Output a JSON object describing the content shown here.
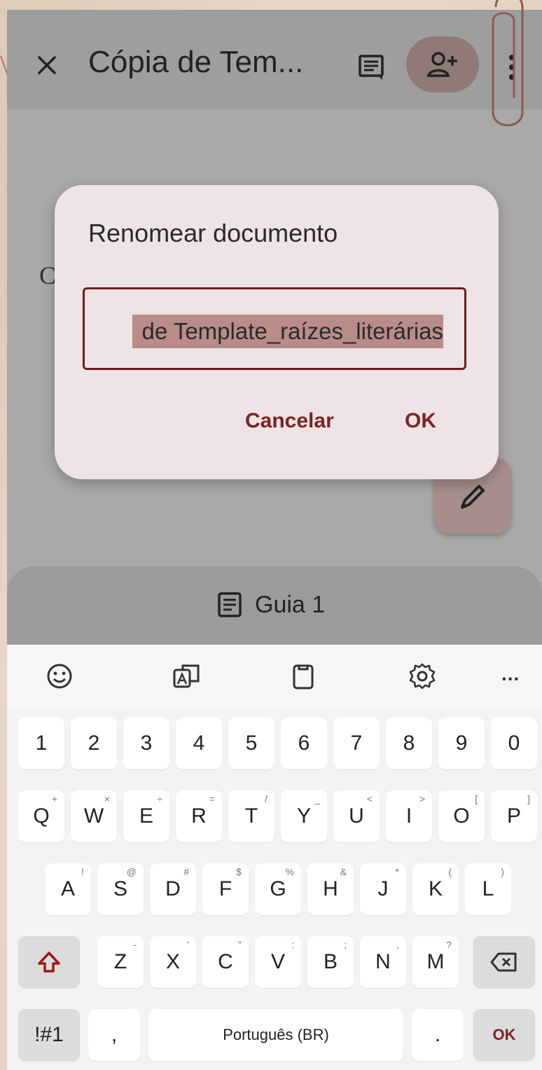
{
  "app_bar": {
    "title": "Cópia de Tem...",
    "close_icon": "close-icon",
    "comment_icon": "comment-icon",
    "share_icon": "person-add-icon",
    "more_icon": "more-vert-icon"
  },
  "document": {
    "visible_letter": "C"
  },
  "dialog": {
    "title": "Renomear documento",
    "field_value": "de Template_raízes_literárias",
    "cancel_label": "Cancelar",
    "ok_label": "OK"
  },
  "tab_bar": {
    "tab_label": "Guia 1",
    "tab_icon": "document-icon"
  },
  "keyboard": {
    "toolbar_icons": [
      "emoji-icon",
      "translate-icon",
      "clipboard-icon",
      "settings-icon",
      "more-horiz-icon"
    ],
    "more_label": "...",
    "row_numbers": [
      "1",
      "2",
      "3",
      "4",
      "5",
      "6",
      "7",
      "8",
      "9",
      "0"
    ],
    "row_q": [
      {
        "key": "Q",
        "sup": "+"
      },
      {
        "key": "W",
        "sup": "×"
      },
      {
        "key": "E",
        "sup": "÷"
      },
      {
        "key": "R",
        "sup": "="
      },
      {
        "key": "T",
        "sup": "/"
      },
      {
        "key": "Y",
        "sup": "_"
      },
      {
        "key": "U",
        "sup": "<"
      },
      {
        "key": "I",
        "sup": ">"
      },
      {
        "key": "O",
        "sup": "["
      },
      {
        "key": "P",
        "sup": "]"
      }
    ],
    "row_a": [
      {
        "key": "A",
        "sup": "!"
      },
      {
        "key": "S",
        "sup": "@"
      },
      {
        "key": "D",
        "sup": "#"
      },
      {
        "key": "F",
        "sup": "$"
      },
      {
        "key": "G",
        "sup": "%"
      },
      {
        "key": "H",
        "sup": "&"
      },
      {
        "key": "J",
        "sup": "*"
      },
      {
        "key": "K",
        "sup": "("
      },
      {
        "key": "L",
        "sup": ")"
      }
    ],
    "row_z": [
      {
        "key": "Z",
        "sup": "-"
      },
      {
        "key": "X",
        "sup": "'"
      },
      {
        "key": "C",
        "sup": "\""
      },
      {
        "key": "V",
        "sup": ":"
      },
      {
        "key": "B",
        "sup": ";"
      },
      {
        "key": "N",
        "sup": ","
      },
      {
        "key": "M",
        "sup": "?"
      }
    ],
    "symbols_label": "!#1",
    "comma_label": ",",
    "space_label": "Português (BR)",
    "period_label": ".",
    "enter_label": "OK"
  },
  "colors": {
    "accent": "#7a2424",
    "dialog_bg": "#eee3e5",
    "scrim": "#a9a9a9"
  }
}
